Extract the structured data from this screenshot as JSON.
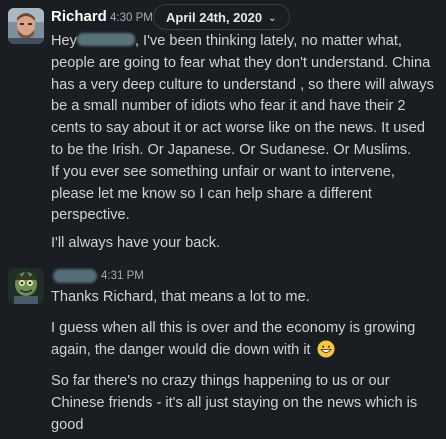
{
  "date_divider": {
    "label": "April 24th, 2020",
    "chevron_icon": "chevron-down-icon"
  },
  "messages": [
    {
      "author": "Richard",
      "time": "4:30 PM",
      "avatar_icon": "user-photo-avatar",
      "paragraphs": [
        {
          "lines": [
            {
              "before_blur": "Hey",
              "after_blur": ", I've been thinking lately, no matter what,"
            },
            {
              "text": "people are going to fear what they don't understand. China"
            },
            {
              "text": "has a very deep culture to understand , so there will always"
            },
            {
              "text": "be a small number of idiots who fear it and have their 2"
            },
            {
              "text": "cents to say about it or act worse like on the news. It used"
            },
            {
              "text": "to be the Irish. Or Japanese. Or Sudanese. Or Muslims."
            },
            {
              "text": "If you ever see something unfair or want to intervene,"
            },
            {
              "text": "please let me know so I can help share a different"
            },
            {
              "text": "perspective."
            }
          ]
        },
        {
          "lines": [
            {
              "text": "I'll always have your back."
            }
          ]
        }
      ]
    },
    {
      "author": "",
      "time": "4:31 PM",
      "avatar_icon": "zombie-avatar",
      "paragraphs": [
        {
          "lines": [
            {
              "text": "Thanks Richard, that means a lot to me."
            }
          ]
        },
        {
          "lines": [
            {
              "text": "I guess when all this is over and the economy is growing"
            },
            {
              "text": "again, the danger would die down with it"
            }
          ],
          "emoji": "grinning-face-emoji"
        },
        {
          "lines": [
            {
              "text": "So far there's no crazy things happening to us or our"
            },
            {
              "text": "Chinese friends - it's all just staying on the news which is"
            },
            {
              "text": "good"
            }
          ]
        }
      ]
    }
  ]
}
